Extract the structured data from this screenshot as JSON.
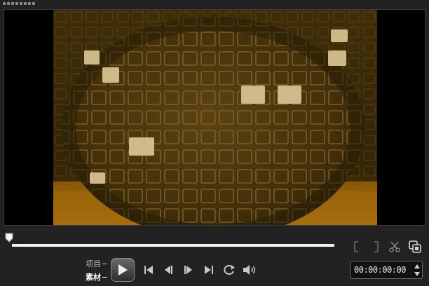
{
  "modes": {
    "project_label": "项目",
    "clip_label": "素材",
    "active": "clip"
  },
  "playback": {
    "position": 0.0
  },
  "timecode": {
    "value": "00:00:00:00"
  },
  "icons": {
    "mark_in": "mark-in-bracket-icon",
    "mark_out": "mark-out-bracket-icon",
    "split": "scissors-icon",
    "enlarge": "enlarge-preview-icon",
    "play": "play-icon",
    "home": "skip-to-start-icon",
    "prev_frame": "previous-frame-icon",
    "next_frame": "next-frame-icon",
    "end": "skip-to-end-icon",
    "repeat": "repeat-icon",
    "volume": "volume-icon"
  },
  "colors": {
    "accent": "#f2f2f2",
    "video_tint": "#6a4a0c"
  }
}
